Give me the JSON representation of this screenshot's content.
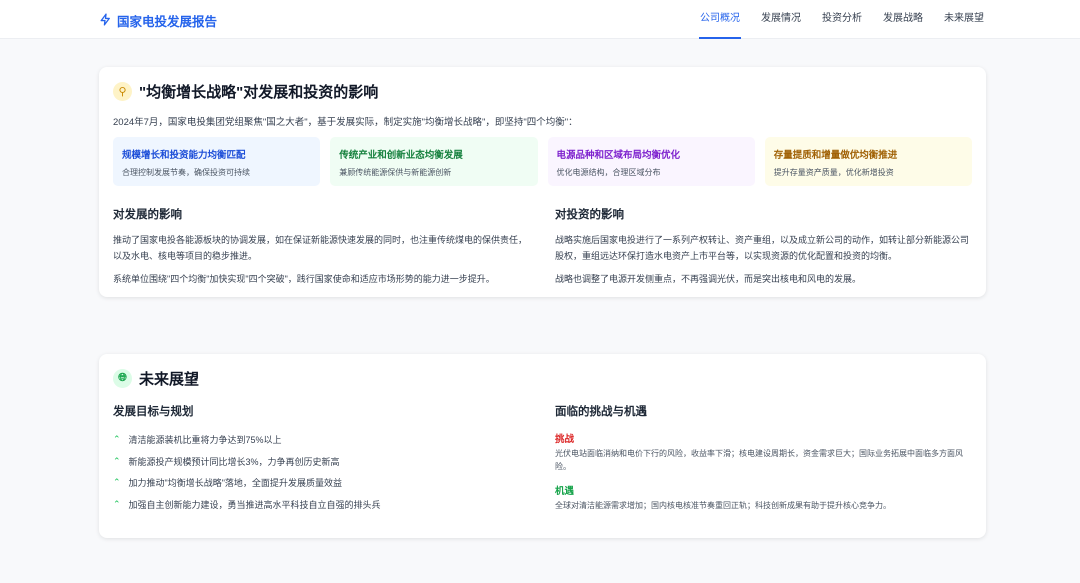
{
  "header": {
    "title": "国家电投发展报告",
    "nav": [
      "公司概况",
      "发展情况",
      "投资分析",
      "发展战略",
      "未来展望"
    ],
    "active": 0
  },
  "strategy": {
    "title": "\"均衡增长战略\"对发展和投资的影响",
    "intro": "2024年7月，国家电投集团党组聚焦\"国之大者\"，基于发展实际，制定实施\"均衡增长战略\"，即坚持\"四个均衡\"：",
    "balances": [
      {
        "title": "规模增长和投资能力均衡匹配",
        "desc": "合理控制发展节奏，确保投资可持续",
        "color": "#1d4ed8",
        "bg": "#eff6ff"
      },
      {
        "title": "传统产业和创新业态均衡发展",
        "desc": "兼顾传统能源保供与新能源创新",
        "color": "#15803d",
        "bg": "#f0fdf4"
      },
      {
        "title": "电源品种和区域布局均衡优化",
        "desc": "优化电源结构，合理区域分布",
        "color": "#7e22ce",
        "bg": "#faf5ff"
      },
      {
        "title": "存量提质和增量做优均衡推进",
        "desc": "提升存量资产质量，优化新增投资",
        "color": "#a16207",
        "bg": "#fefce8"
      }
    ],
    "dev": {
      "title": "对发展的影响",
      "paras": [
        "推动了国家电投各能源板块的协调发展，如在保证新能源快速发展的同时，也注重传统煤电的保供责任，以及水电、核电等项目的稳步推进。",
        "系统单位围绕\"四个均衡\"加快实现\"四个突破\"，践行国家使命和适应市场形势的能力进一步提升。"
      ]
    },
    "inv": {
      "title": "对投资的影响",
      "paras": [
        "战略实施后国家电投进行了一系列产权转让、资产重组，以及成立新公司的动作，如转让部分新能源公司股权，重组远达环保打造水电资产上市平台等，以实现资源的优化配置和投资的均衡。",
        "战略也调整了电源开发侧重点，不再强调光伏，而是突出核电和风电的发展。"
      ]
    }
  },
  "outlook": {
    "title": "未来展望",
    "goals": {
      "title": "发展目标与规划",
      "items": [
        "清洁能源装机比重将力争达到75%以上",
        "新能源投产规模预计同比增长3%，力争再创历史新高",
        "加力推动\"均衡增长战略\"落地，全面提升发展质量效益",
        "加强自主创新能力建设，勇当推进高水平科技自立自强的排头兵"
      ]
    },
    "ch": {
      "title": "面临的挑战与机遇",
      "challenge_label": "挑战",
      "challenge": "光伏电站面临消纳和电价下行的风险，收益率下滑；核电建设周期长，资金需求巨大；国际业务拓展中面临多方面风险。",
      "opp_label": "机遇",
      "opp": "全球对清洁能源需求增加；国内核电核准节奏重回正轨；科技创新成果有助于提升核心竞争力。"
    }
  }
}
